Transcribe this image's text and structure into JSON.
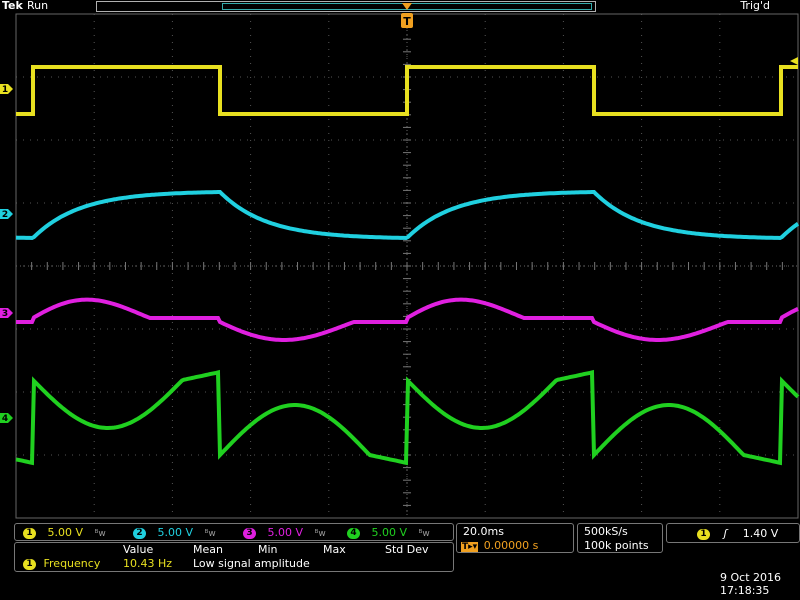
{
  "header": {
    "brand": "Tek",
    "state": "Run",
    "trigger_status": "Trig'd",
    "trigger_marker": "T"
  },
  "channels": [
    {
      "num": "1",
      "color": "#e8e020",
      "scale": "5.00 V"
    },
    {
      "num": "2",
      "color": "#20d0e0",
      "scale": "5.00 V"
    },
    {
      "num": "3",
      "color": "#e020e0",
      "scale": "5.00 V"
    },
    {
      "num": "4",
      "color": "#20d020",
      "scale": "5.00 V"
    }
  ],
  "bw_symbol": "ᴮw",
  "timebase": {
    "scale": "20.0ms",
    "trigger_pos": "0.00000 s",
    "trigger_pos_icon": "T▸▾"
  },
  "acquisition": {
    "rate": "500kS/s",
    "record": "100k points"
  },
  "trigger": {
    "source": "1",
    "slope_icon": "ʃ",
    "level": "1.40 V"
  },
  "measurements": {
    "headers": [
      "Value",
      "Mean",
      "Min",
      "Max",
      "Std Dev"
    ],
    "rows": [
      {
        "channel": "1",
        "name": "Frequency",
        "value": "10.43 Hz",
        "note": "Low signal amplitude"
      }
    ]
  },
  "datetime": {
    "date": "9 Oct  2016",
    "time": "17:18:35"
  }
}
